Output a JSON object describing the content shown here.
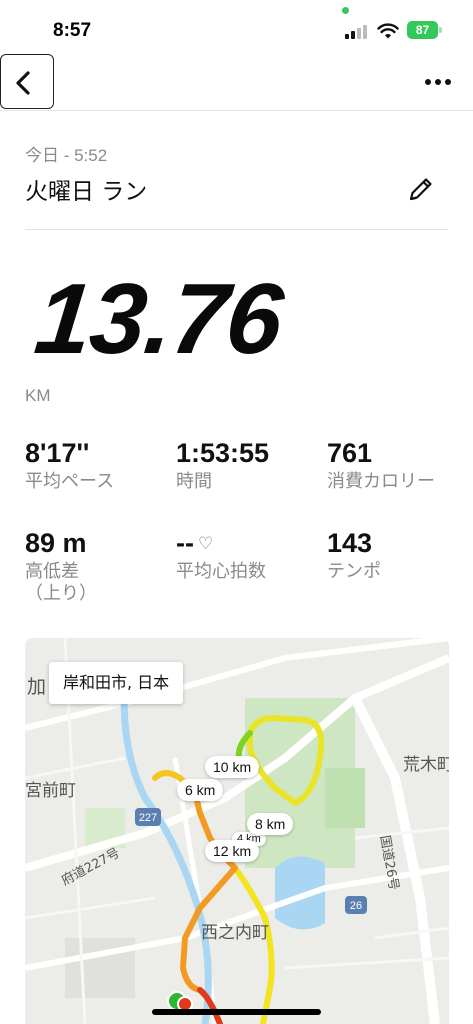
{
  "status_bar": {
    "time": "8:57",
    "battery": "87"
  },
  "workout": {
    "date": "今日 - 5:52",
    "title": "火曜日 ラン",
    "distance": "13.76",
    "distance_unit": "KM"
  },
  "stats": [
    {
      "value": "8'17''",
      "label": "平均ペース"
    },
    {
      "value": "1:53:55",
      "label": "時間"
    },
    {
      "value": "761",
      "label": "消費カロリー"
    },
    {
      "value": "89 m",
      "label": "高低差\n（上り）"
    },
    {
      "value": "--",
      "label": "平均心拍数"
    },
    {
      "value": "143",
      "label": "テンポ"
    }
  ],
  "map": {
    "location": "岸和田市, 日本",
    "km_markers": [
      "10 km",
      "6 km",
      "8 km",
      "12 km",
      "4 km"
    ],
    "place_names": [
      "加",
      "宮前町",
      "荒木町",
      "西之内町"
    ],
    "road_labels": [
      "府道227号",
      "国道26号",
      "227",
      "26"
    ],
    "route_colors": {
      "fast": "#f2e41f",
      "medium": "#f39a22",
      "slow": "#e2391b",
      "start": "#2fb534"
    }
  },
  "icons": {
    "back": "chevron-left-icon",
    "more": "ellipsis-icon",
    "edit": "pencil-icon",
    "heart": "heart-icon"
  }
}
